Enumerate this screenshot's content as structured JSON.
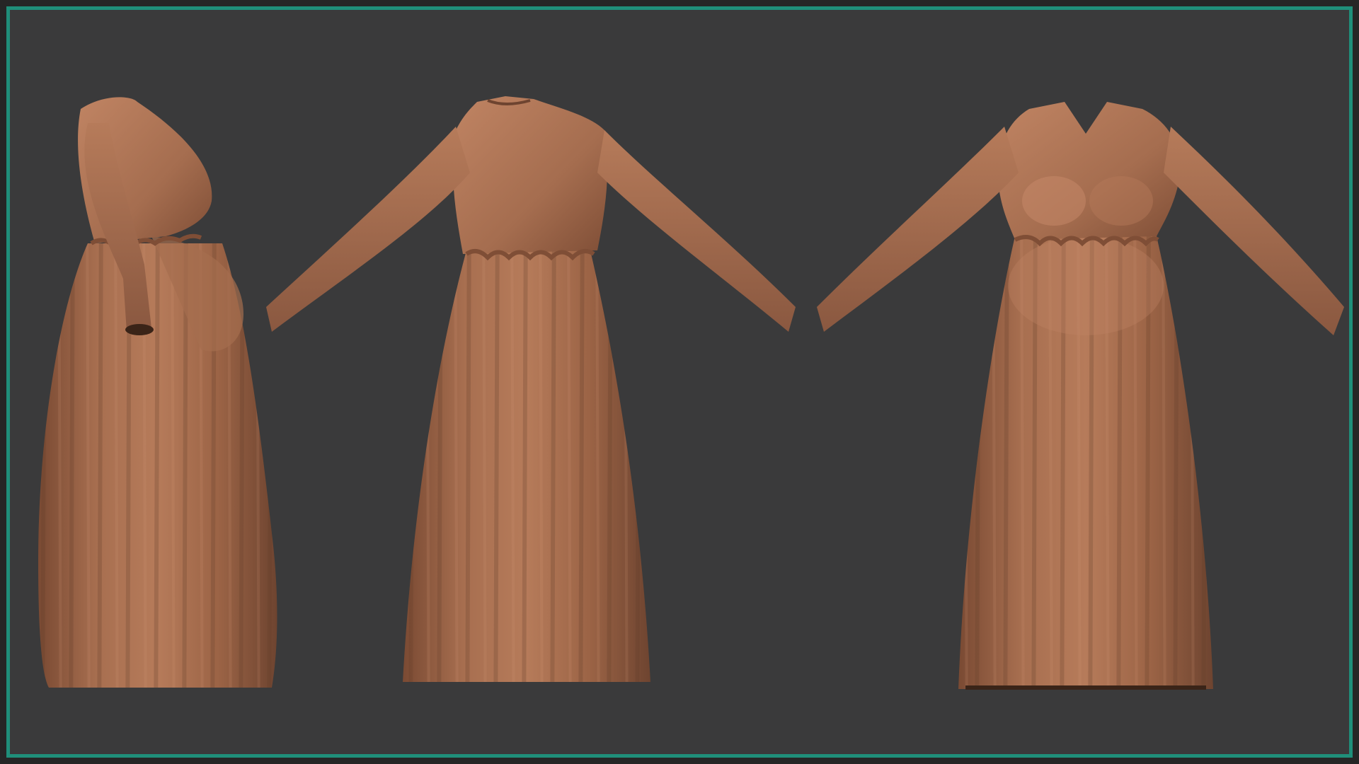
{
  "scene": {
    "background": "#3a3a3b",
    "frame_color": "#1f8f7a",
    "fabric_base": "#a06a4c",
    "fabric_light": "#c08463",
    "fabric_shadow": "#6e4430",
    "views": [
      {
        "id": "side",
        "icon": "dress-side-view"
      },
      {
        "id": "back",
        "icon": "dress-back-view"
      },
      {
        "id": "front",
        "icon": "dress-front-view"
      }
    ]
  }
}
